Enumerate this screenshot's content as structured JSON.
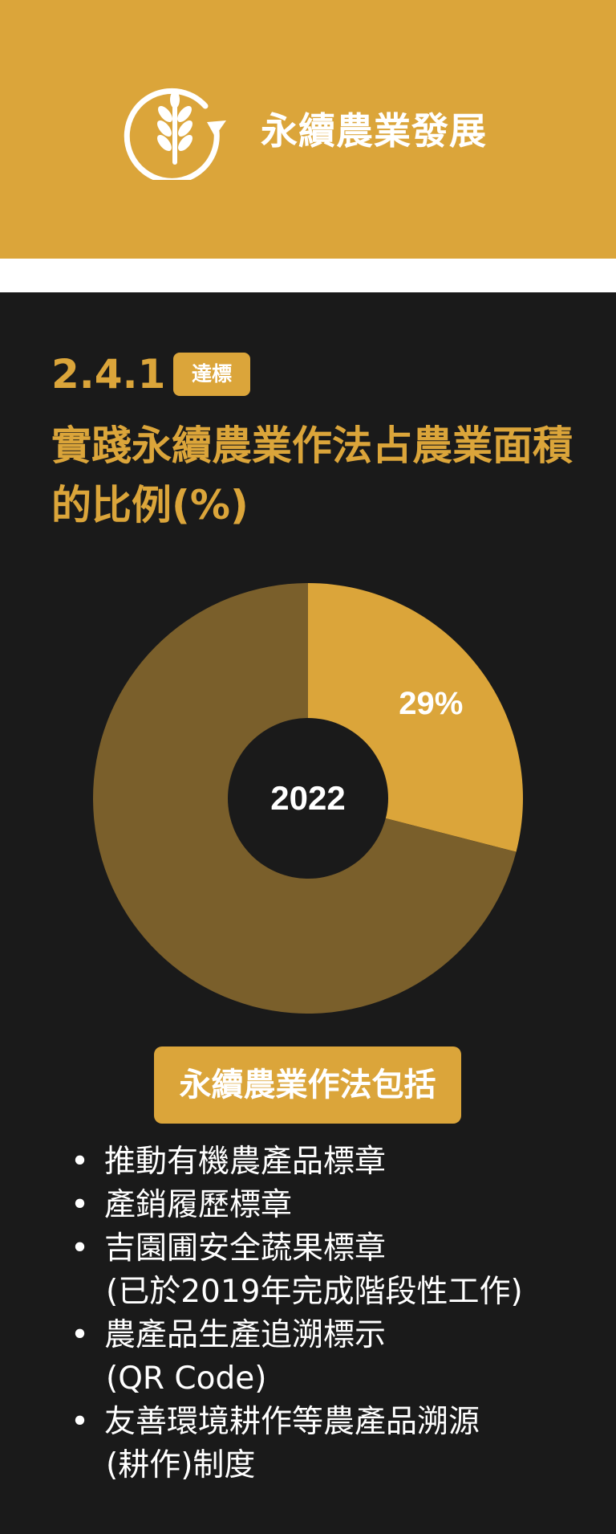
{
  "header": {
    "title": "永續農業發展",
    "icon": "wheat-cycle-icon"
  },
  "indicator": {
    "code": "2.4.1",
    "status": "達標",
    "title": "實踐永續農業作法占農業面積的比例(%)"
  },
  "colors": {
    "accent": "#dba53a",
    "accent_dark": "#7a5f2b",
    "background": "#1a1a1a",
    "text": "#ffffff"
  },
  "chart_data": {
    "type": "pie",
    "style": "donut",
    "center_label": "2022",
    "slices": [
      {
        "value": 29,
        "label": "29%",
        "color": "#dba53a"
      },
      {
        "value": 71,
        "label": "",
        "color": "#7a5f2b"
      }
    ]
  },
  "methods": {
    "heading": "永續農業作法包括",
    "bullet": "•",
    "items": [
      {
        "line1": "推動有機農產品標章",
        "line2": ""
      },
      {
        "line1": "產銷履歷標章",
        "line2": ""
      },
      {
        "line1": "吉園圃安全蔬果標章",
        "line2": "(已於2019年完成階段性工作)"
      },
      {
        "line1": "農產品生產追溯標示",
        "line2": "(QR Code)"
      },
      {
        "line1": "友善環境耕作等農產品溯源",
        "line2": "(耕作)制度"
      }
    ]
  }
}
